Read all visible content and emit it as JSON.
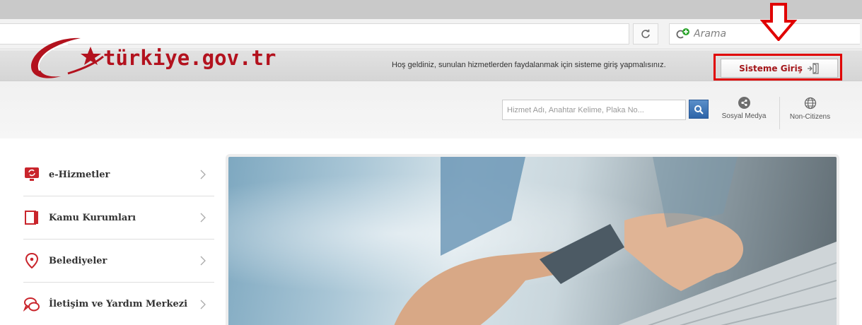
{
  "browser": {
    "search_placeholder": "Arama"
  },
  "header": {
    "welcome_text": "Hoş geldiniz, sunulan hizmetlerden faydalanmak için sisteme giriş yapmalısınız.",
    "login_label": "Sisteme Giriş",
    "logo_text": "türkiye.gov.tr",
    "search_placeholder": "Hizmet Adı, Anahtar Kelime, Plaka No...",
    "social_label": "Sosyal Medya",
    "noncitizens_label": "Non-Citizens"
  },
  "sidebar": {
    "items": [
      {
        "label": "e-Hizmetler",
        "icon": "monitor-icon"
      },
      {
        "label": "Kamu Kurumları",
        "icon": "building-book-icon"
      },
      {
        "label": "Belediyeler",
        "icon": "location-pin-icon"
      },
      {
        "label": "İletişim ve Yardım Merkezi",
        "icon": "chat-bubbles-icon"
      }
    ]
  },
  "colors": {
    "brand_red": "#b3121e",
    "annotation_red": "#e00000",
    "search_blue": "#2d64a8"
  }
}
